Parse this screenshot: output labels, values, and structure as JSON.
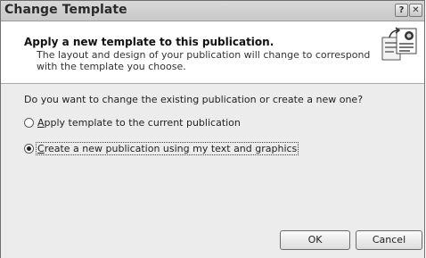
{
  "window": {
    "title": "Change Template",
    "help_glyph": "?",
    "close_glyph": "✕"
  },
  "header": {
    "title": "Apply a new template to this publication.",
    "description": "The layout and design of your publication will change to correspond with the template you choose.",
    "icon": "template-documents-icon"
  },
  "body": {
    "question": "Do you want to change the existing publication or create a new one?",
    "options": [
      {
        "access_key": "A",
        "label_rest": "pply template to the current publication",
        "selected": false
      },
      {
        "access_key": "C",
        "label_rest": "reate a new publication using my text and graphics",
        "selected": true
      }
    ]
  },
  "buttons": {
    "ok": "OK",
    "cancel": "Cancel"
  }
}
